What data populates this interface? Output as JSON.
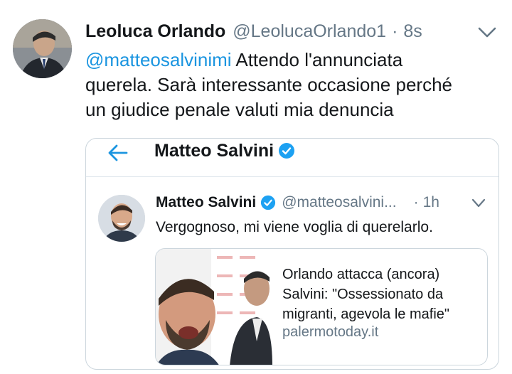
{
  "tweet": {
    "author_name": "Leoluca Orlando",
    "author_handle": "@LeolucaOrlando1",
    "separator": "·",
    "time": "8s",
    "mention": "@matteosalvinimi",
    "text_line1_rest": " Attendo l'annunciata",
    "text_line2": "querela. Sarà interessante occasione perché",
    "text_line3": "un giudice penale valuti mia denuncia"
  },
  "quoted": {
    "profile_title": "Matteo Salvini",
    "author_name": "Matteo Salvini",
    "author_handle": "@matteosalvini...",
    "separator": "·",
    "time": "1h",
    "text": "Vergognoso, mi viene voglia di querelarlo.",
    "card": {
      "title_line1": "Orlando attacca (ancora)",
      "title_line2": "Salvini: \"Ossessionato da",
      "title_line3": "migranti, agevola le mafie\"",
      "domain": "palermotoday.it"
    }
  },
  "icons": {
    "chevron": "chevron-down-icon",
    "back": "arrow-left-icon",
    "verified": "verified-badge-icon"
  },
  "colors": {
    "accent": "#1b95e0",
    "text": "#14171a",
    "secondary": "#657786",
    "border": "#ccd6dd"
  }
}
